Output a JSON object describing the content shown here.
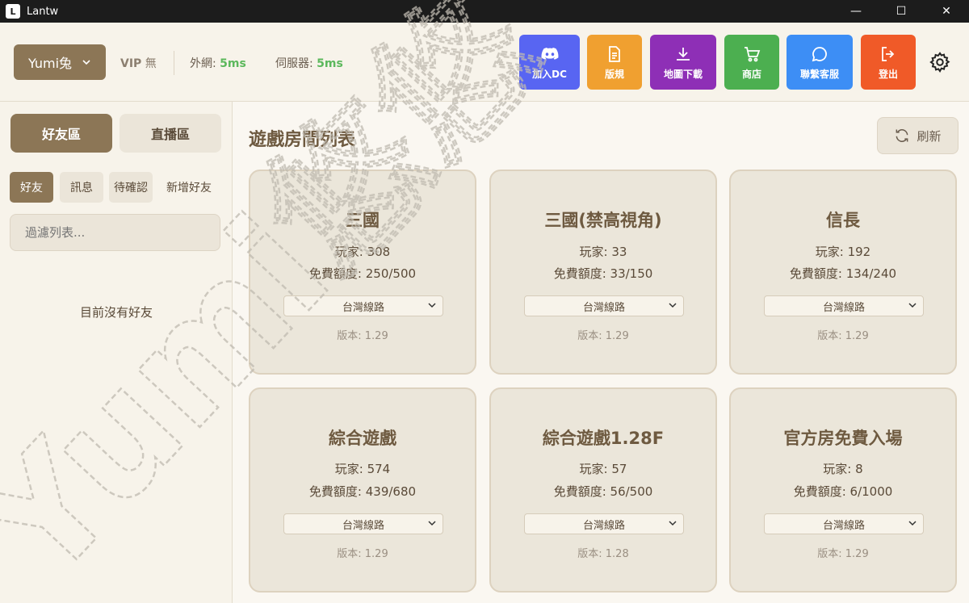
{
  "window": {
    "title": "Lantw",
    "app_icon_letter": "L",
    "minimize_glyph": "—",
    "maximize_glyph": "☐",
    "close_glyph": "✕"
  },
  "header": {
    "user_label": "Yumi兔",
    "vip_label": "VIP",
    "vip_value": "無",
    "external_label": "外網:",
    "external_ms": "5ms",
    "server_label": "伺服器:",
    "server_ms": "5ms",
    "buttons": [
      {
        "label": "加入DC",
        "icon": "discord-icon",
        "color": "#5865f2"
      },
      {
        "label": "版規",
        "icon": "document-icon",
        "color": "#f0a030"
      },
      {
        "label": "地圖下載",
        "icon": "download-icon",
        "color": "#8e2fb6"
      },
      {
        "label": "商店",
        "icon": "cart-icon",
        "color": "#4caf50"
      },
      {
        "label": "聯繫客服",
        "icon": "chat-icon",
        "color": "#3d8ef5"
      },
      {
        "label": "登出",
        "icon": "logout-icon",
        "color": "#f05a28"
      }
    ]
  },
  "sidebar": {
    "zones": [
      "好友區",
      "直播區"
    ],
    "tabs": [
      "好友",
      "訊息",
      "待確認",
      "新增好友"
    ],
    "filter_placeholder": "過濾列表...",
    "empty_text": "目前沒有好友"
  },
  "main": {
    "title": "遊戲房間列表",
    "refresh_label": "刷新",
    "players_label": "玩家:",
    "quota_label": "免費額度:",
    "version_label": "版本:",
    "rooms": [
      {
        "name": "三國",
        "players": "308",
        "quota": "250/500",
        "route": "台灣線路",
        "version": "1.29"
      },
      {
        "name": "三國(禁高視角)",
        "players": "33",
        "quota": "33/150",
        "route": "台灣線路",
        "version": "1.29"
      },
      {
        "name": "信長",
        "players": "192",
        "quota": "134/240",
        "route": "台灣線路",
        "version": "1.29"
      },
      {
        "name": "綜合遊戲",
        "players": "574",
        "quota": "439/680",
        "route": "台灣線路",
        "version": "1.29"
      },
      {
        "name": "綜合遊戲1.28F",
        "players": "57",
        "quota": "56/500",
        "route": "台灣線路",
        "version": "1.28"
      },
      {
        "name": "官方房免費入場",
        "players": "8",
        "quota": "6/1000",
        "route": "台灣線路",
        "version": "1.29"
      }
    ]
  },
  "watermark_text": "Yumi悠悠"
}
